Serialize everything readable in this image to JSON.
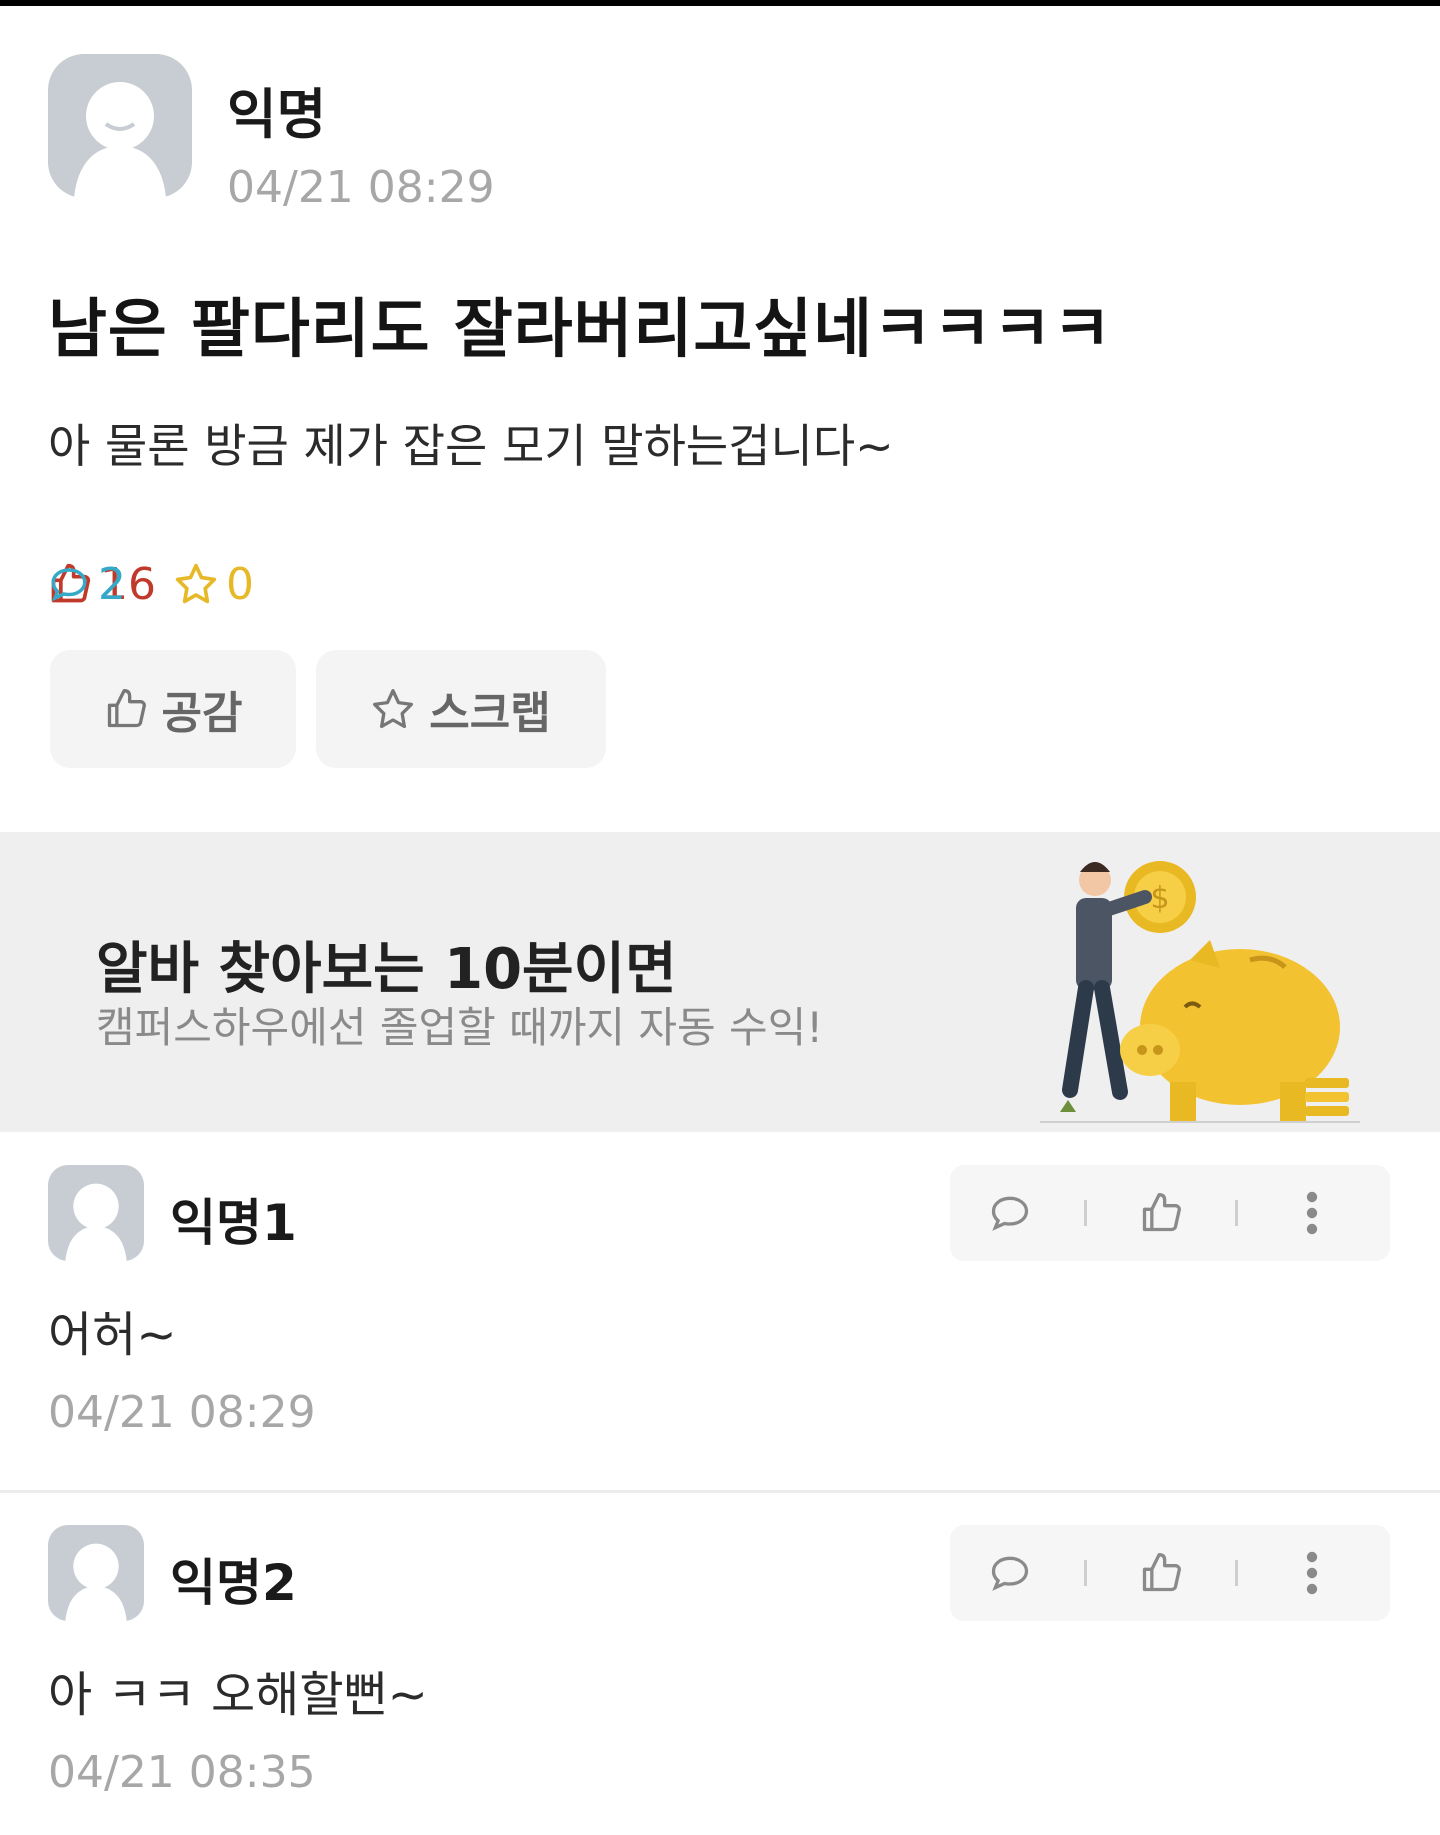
{
  "post": {
    "author": "익명",
    "time": "04/21 08:29",
    "title": "남은 팔다리도 잘라버리고싶네ㅋㅋㅋㅋ",
    "body": "아 물론 방금 제가 잡은 모기 말하는겁니다~",
    "stats": {
      "likes": "16",
      "comments": "2",
      "scraps": "0"
    },
    "like_button": "공감",
    "scrap_button": "스크랩"
  },
  "banner": {
    "title": "알바 찾아보는 10분이면",
    "subtitle": "캠퍼스하우에선 졸업할 때까지 자동 수익!"
  },
  "comments": [
    {
      "author": "익명1",
      "text": "어허~",
      "time": "04/21 08:29"
    },
    {
      "author": "익명2",
      "text": "아 ㅋㅋ 오해할뻔~",
      "time": "04/21 08:35"
    }
  ],
  "colors": {
    "like": "#c0392b",
    "comment": "#36a9c9",
    "scrap": "#e7b928",
    "muted": "#a7a7a7"
  },
  "icons": [
    "thumbs-up-icon",
    "speech-bubble-icon",
    "star-icon",
    "more-vertical-icon",
    "piggy-bank-illustration"
  ]
}
